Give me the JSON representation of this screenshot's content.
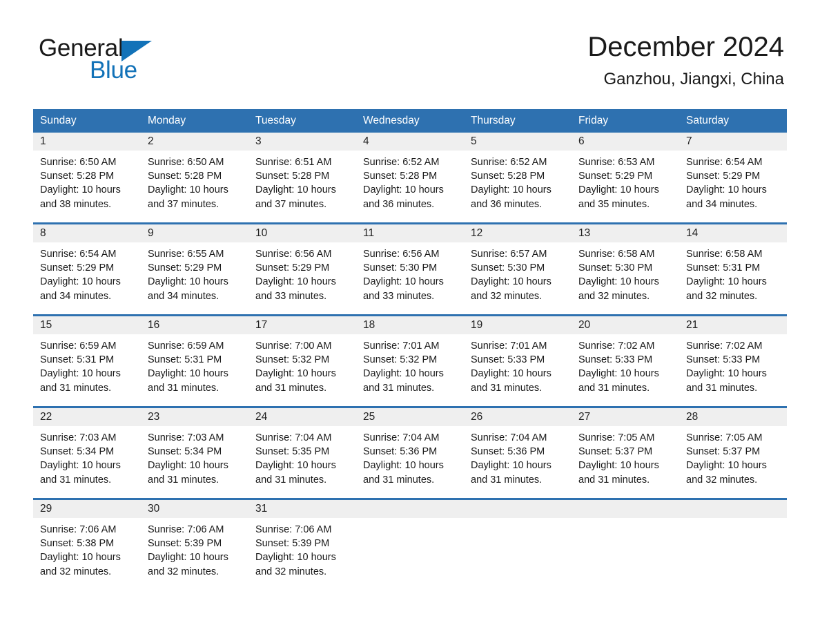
{
  "brand": {
    "name_part1": "General",
    "name_part2": "Blue",
    "triangle_color": "#1272b8"
  },
  "header": {
    "title": "December 2024",
    "subtitle": "Ganzhou, Jiangxi, China"
  },
  "theme": {
    "header_blue": "#2e71b0",
    "daynum_bg": "#efefef",
    "text": "#1a1a1a"
  },
  "weekday_headers": [
    "Sunday",
    "Monday",
    "Tuesday",
    "Wednesday",
    "Thursday",
    "Friday",
    "Saturday"
  ],
  "weeks": [
    [
      {
        "day": "1",
        "sunrise": "Sunrise: 6:50 AM",
        "sunset": "Sunset: 5:28 PM",
        "daylight_line1": "Daylight: 10 hours",
        "daylight_line2": "and 38 minutes."
      },
      {
        "day": "2",
        "sunrise": "Sunrise: 6:50 AM",
        "sunset": "Sunset: 5:28 PM",
        "daylight_line1": "Daylight: 10 hours",
        "daylight_line2": "and 37 minutes."
      },
      {
        "day": "3",
        "sunrise": "Sunrise: 6:51 AM",
        "sunset": "Sunset: 5:28 PM",
        "daylight_line1": "Daylight: 10 hours",
        "daylight_line2": "and 37 minutes."
      },
      {
        "day": "4",
        "sunrise": "Sunrise: 6:52 AM",
        "sunset": "Sunset: 5:28 PM",
        "daylight_line1": "Daylight: 10 hours",
        "daylight_line2": "and 36 minutes."
      },
      {
        "day": "5",
        "sunrise": "Sunrise: 6:52 AM",
        "sunset": "Sunset: 5:28 PM",
        "daylight_line1": "Daylight: 10 hours",
        "daylight_line2": "and 36 minutes."
      },
      {
        "day": "6",
        "sunrise": "Sunrise: 6:53 AM",
        "sunset": "Sunset: 5:29 PM",
        "daylight_line1": "Daylight: 10 hours",
        "daylight_line2": "and 35 minutes."
      },
      {
        "day": "7",
        "sunrise": "Sunrise: 6:54 AM",
        "sunset": "Sunset: 5:29 PM",
        "daylight_line1": "Daylight: 10 hours",
        "daylight_line2": "and 34 minutes."
      }
    ],
    [
      {
        "day": "8",
        "sunrise": "Sunrise: 6:54 AM",
        "sunset": "Sunset: 5:29 PM",
        "daylight_line1": "Daylight: 10 hours",
        "daylight_line2": "and 34 minutes."
      },
      {
        "day": "9",
        "sunrise": "Sunrise: 6:55 AM",
        "sunset": "Sunset: 5:29 PM",
        "daylight_line1": "Daylight: 10 hours",
        "daylight_line2": "and 34 minutes."
      },
      {
        "day": "10",
        "sunrise": "Sunrise: 6:56 AM",
        "sunset": "Sunset: 5:29 PM",
        "daylight_line1": "Daylight: 10 hours",
        "daylight_line2": "and 33 minutes."
      },
      {
        "day": "11",
        "sunrise": "Sunrise: 6:56 AM",
        "sunset": "Sunset: 5:30 PM",
        "daylight_line1": "Daylight: 10 hours",
        "daylight_line2": "and 33 minutes."
      },
      {
        "day": "12",
        "sunrise": "Sunrise: 6:57 AM",
        "sunset": "Sunset: 5:30 PM",
        "daylight_line1": "Daylight: 10 hours",
        "daylight_line2": "and 32 minutes."
      },
      {
        "day": "13",
        "sunrise": "Sunrise: 6:58 AM",
        "sunset": "Sunset: 5:30 PM",
        "daylight_line1": "Daylight: 10 hours",
        "daylight_line2": "and 32 minutes."
      },
      {
        "day": "14",
        "sunrise": "Sunrise: 6:58 AM",
        "sunset": "Sunset: 5:31 PM",
        "daylight_line1": "Daylight: 10 hours",
        "daylight_line2": "and 32 minutes."
      }
    ],
    [
      {
        "day": "15",
        "sunrise": "Sunrise: 6:59 AM",
        "sunset": "Sunset: 5:31 PM",
        "daylight_line1": "Daylight: 10 hours",
        "daylight_line2": "and 31 minutes."
      },
      {
        "day": "16",
        "sunrise": "Sunrise: 6:59 AM",
        "sunset": "Sunset: 5:31 PM",
        "daylight_line1": "Daylight: 10 hours",
        "daylight_line2": "and 31 minutes."
      },
      {
        "day": "17",
        "sunrise": "Sunrise: 7:00 AM",
        "sunset": "Sunset: 5:32 PM",
        "daylight_line1": "Daylight: 10 hours",
        "daylight_line2": "and 31 minutes."
      },
      {
        "day": "18",
        "sunrise": "Sunrise: 7:01 AM",
        "sunset": "Sunset: 5:32 PM",
        "daylight_line1": "Daylight: 10 hours",
        "daylight_line2": "and 31 minutes."
      },
      {
        "day": "19",
        "sunrise": "Sunrise: 7:01 AM",
        "sunset": "Sunset: 5:33 PM",
        "daylight_line1": "Daylight: 10 hours",
        "daylight_line2": "and 31 minutes."
      },
      {
        "day": "20",
        "sunrise": "Sunrise: 7:02 AM",
        "sunset": "Sunset: 5:33 PM",
        "daylight_line1": "Daylight: 10 hours",
        "daylight_line2": "and 31 minutes."
      },
      {
        "day": "21",
        "sunrise": "Sunrise: 7:02 AM",
        "sunset": "Sunset: 5:33 PM",
        "daylight_line1": "Daylight: 10 hours",
        "daylight_line2": "and 31 minutes."
      }
    ],
    [
      {
        "day": "22",
        "sunrise": "Sunrise: 7:03 AM",
        "sunset": "Sunset: 5:34 PM",
        "daylight_line1": "Daylight: 10 hours",
        "daylight_line2": "and 31 minutes."
      },
      {
        "day": "23",
        "sunrise": "Sunrise: 7:03 AM",
        "sunset": "Sunset: 5:34 PM",
        "daylight_line1": "Daylight: 10 hours",
        "daylight_line2": "and 31 minutes."
      },
      {
        "day": "24",
        "sunrise": "Sunrise: 7:04 AM",
        "sunset": "Sunset: 5:35 PM",
        "daylight_line1": "Daylight: 10 hours",
        "daylight_line2": "and 31 minutes."
      },
      {
        "day": "25",
        "sunrise": "Sunrise: 7:04 AM",
        "sunset": "Sunset: 5:36 PM",
        "daylight_line1": "Daylight: 10 hours",
        "daylight_line2": "and 31 minutes."
      },
      {
        "day": "26",
        "sunrise": "Sunrise: 7:04 AM",
        "sunset": "Sunset: 5:36 PM",
        "daylight_line1": "Daylight: 10 hours",
        "daylight_line2": "and 31 minutes."
      },
      {
        "day": "27",
        "sunrise": "Sunrise: 7:05 AM",
        "sunset": "Sunset: 5:37 PM",
        "daylight_line1": "Daylight: 10 hours",
        "daylight_line2": "and 31 minutes."
      },
      {
        "day": "28",
        "sunrise": "Sunrise: 7:05 AM",
        "sunset": "Sunset: 5:37 PM",
        "daylight_line1": "Daylight: 10 hours",
        "daylight_line2": "and 32 minutes."
      }
    ],
    [
      {
        "day": "29",
        "sunrise": "Sunrise: 7:06 AM",
        "sunset": "Sunset: 5:38 PM",
        "daylight_line1": "Daylight: 10 hours",
        "daylight_line2": "and 32 minutes."
      },
      {
        "day": "30",
        "sunrise": "Sunrise: 7:06 AM",
        "sunset": "Sunset: 5:39 PM",
        "daylight_line1": "Daylight: 10 hours",
        "daylight_line2": "and 32 minutes."
      },
      {
        "day": "31",
        "sunrise": "Sunrise: 7:06 AM",
        "sunset": "Sunset: 5:39 PM",
        "daylight_line1": "Daylight: 10 hours",
        "daylight_line2": "and 32 minutes."
      },
      {
        "day": "",
        "sunrise": "",
        "sunset": "",
        "daylight_line1": "",
        "daylight_line2": ""
      },
      {
        "day": "",
        "sunrise": "",
        "sunset": "",
        "daylight_line1": "",
        "daylight_line2": ""
      },
      {
        "day": "",
        "sunrise": "",
        "sunset": "",
        "daylight_line1": "",
        "daylight_line2": ""
      },
      {
        "day": "",
        "sunrise": "",
        "sunset": "",
        "daylight_line1": "",
        "daylight_line2": ""
      }
    ]
  ]
}
